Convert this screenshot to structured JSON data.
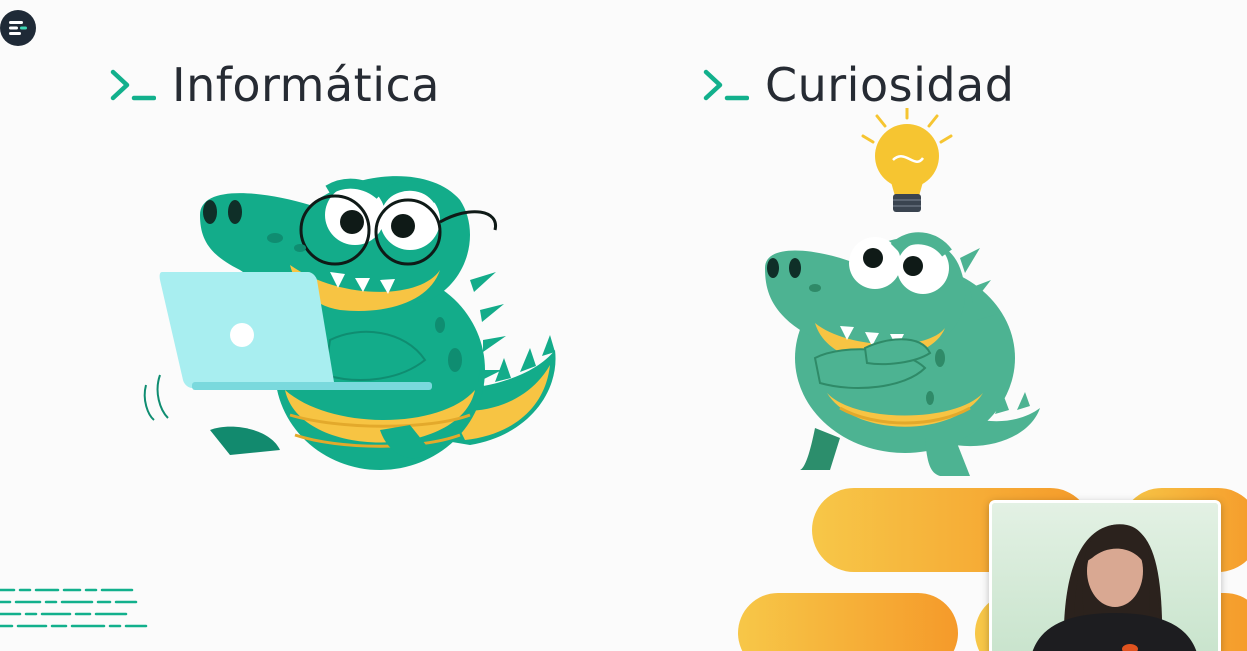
{
  "slide": {
    "left_title": "Informática",
    "right_title": "Curiosidad"
  },
  "icons": {
    "app_logo": "menu-logo-icon",
    "prompt": "terminal-prompt-icon"
  },
  "colors": {
    "accent_green": "#12b08c",
    "croc_green": "#13ac8a",
    "croc_green_light": "#4db392",
    "croc_belly": "#f7c443",
    "laptop": "#a8eef0",
    "bulb": "#f6c531",
    "stripe_orange": "#f59a2a",
    "title_text": "#262b33"
  }
}
